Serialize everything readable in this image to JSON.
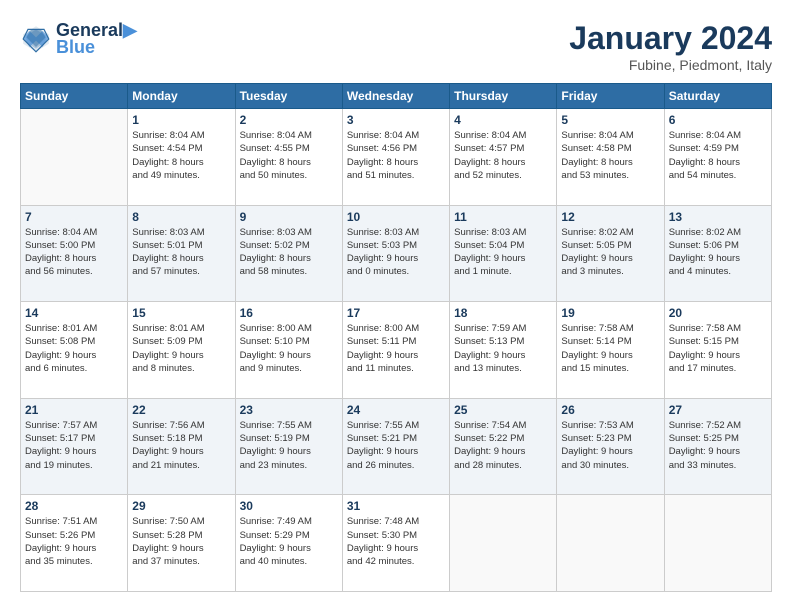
{
  "header": {
    "logo_line1": "General",
    "logo_line2": "Blue",
    "month": "January 2024",
    "location": "Fubine, Piedmont, Italy"
  },
  "days_of_week": [
    "Sunday",
    "Monday",
    "Tuesday",
    "Wednesday",
    "Thursday",
    "Friday",
    "Saturday"
  ],
  "weeks": [
    [
      {
        "day": "",
        "info": ""
      },
      {
        "day": "1",
        "info": "Sunrise: 8:04 AM\nSunset: 4:54 PM\nDaylight: 8 hours\nand 49 minutes."
      },
      {
        "day": "2",
        "info": "Sunrise: 8:04 AM\nSunset: 4:55 PM\nDaylight: 8 hours\nand 50 minutes."
      },
      {
        "day": "3",
        "info": "Sunrise: 8:04 AM\nSunset: 4:56 PM\nDaylight: 8 hours\nand 51 minutes."
      },
      {
        "day": "4",
        "info": "Sunrise: 8:04 AM\nSunset: 4:57 PM\nDaylight: 8 hours\nand 52 minutes."
      },
      {
        "day": "5",
        "info": "Sunrise: 8:04 AM\nSunset: 4:58 PM\nDaylight: 8 hours\nand 53 minutes."
      },
      {
        "day": "6",
        "info": "Sunrise: 8:04 AM\nSunset: 4:59 PM\nDaylight: 8 hours\nand 54 minutes."
      }
    ],
    [
      {
        "day": "7",
        "info": "Sunrise: 8:04 AM\nSunset: 5:00 PM\nDaylight: 8 hours\nand 56 minutes."
      },
      {
        "day": "8",
        "info": "Sunrise: 8:03 AM\nSunset: 5:01 PM\nDaylight: 8 hours\nand 57 minutes."
      },
      {
        "day": "9",
        "info": "Sunrise: 8:03 AM\nSunset: 5:02 PM\nDaylight: 8 hours\nand 58 minutes."
      },
      {
        "day": "10",
        "info": "Sunrise: 8:03 AM\nSunset: 5:03 PM\nDaylight: 9 hours\nand 0 minutes."
      },
      {
        "day": "11",
        "info": "Sunrise: 8:03 AM\nSunset: 5:04 PM\nDaylight: 9 hours\nand 1 minute."
      },
      {
        "day": "12",
        "info": "Sunrise: 8:02 AM\nSunset: 5:05 PM\nDaylight: 9 hours\nand 3 minutes."
      },
      {
        "day": "13",
        "info": "Sunrise: 8:02 AM\nSunset: 5:06 PM\nDaylight: 9 hours\nand 4 minutes."
      }
    ],
    [
      {
        "day": "14",
        "info": "Sunrise: 8:01 AM\nSunset: 5:08 PM\nDaylight: 9 hours\nand 6 minutes."
      },
      {
        "day": "15",
        "info": "Sunrise: 8:01 AM\nSunset: 5:09 PM\nDaylight: 9 hours\nand 8 minutes."
      },
      {
        "day": "16",
        "info": "Sunrise: 8:00 AM\nSunset: 5:10 PM\nDaylight: 9 hours\nand 9 minutes."
      },
      {
        "day": "17",
        "info": "Sunrise: 8:00 AM\nSunset: 5:11 PM\nDaylight: 9 hours\nand 11 minutes."
      },
      {
        "day": "18",
        "info": "Sunrise: 7:59 AM\nSunset: 5:13 PM\nDaylight: 9 hours\nand 13 minutes."
      },
      {
        "day": "19",
        "info": "Sunrise: 7:58 AM\nSunset: 5:14 PM\nDaylight: 9 hours\nand 15 minutes."
      },
      {
        "day": "20",
        "info": "Sunrise: 7:58 AM\nSunset: 5:15 PM\nDaylight: 9 hours\nand 17 minutes."
      }
    ],
    [
      {
        "day": "21",
        "info": "Sunrise: 7:57 AM\nSunset: 5:17 PM\nDaylight: 9 hours\nand 19 minutes."
      },
      {
        "day": "22",
        "info": "Sunrise: 7:56 AM\nSunset: 5:18 PM\nDaylight: 9 hours\nand 21 minutes."
      },
      {
        "day": "23",
        "info": "Sunrise: 7:55 AM\nSunset: 5:19 PM\nDaylight: 9 hours\nand 23 minutes."
      },
      {
        "day": "24",
        "info": "Sunrise: 7:55 AM\nSunset: 5:21 PM\nDaylight: 9 hours\nand 26 minutes."
      },
      {
        "day": "25",
        "info": "Sunrise: 7:54 AM\nSunset: 5:22 PM\nDaylight: 9 hours\nand 28 minutes."
      },
      {
        "day": "26",
        "info": "Sunrise: 7:53 AM\nSunset: 5:23 PM\nDaylight: 9 hours\nand 30 minutes."
      },
      {
        "day": "27",
        "info": "Sunrise: 7:52 AM\nSunset: 5:25 PM\nDaylight: 9 hours\nand 33 minutes."
      }
    ],
    [
      {
        "day": "28",
        "info": "Sunrise: 7:51 AM\nSunset: 5:26 PM\nDaylight: 9 hours\nand 35 minutes."
      },
      {
        "day": "29",
        "info": "Sunrise: 7:50 AM\nSunset: 5:28 PM\nDaylight: 9 hours\nand 37 minutes."
      },
      {
        "day": "30",
        "info": "Sunrise: 7:49 AM\nSunset: 5:29 PM\nDaylight: 9 hours\nand 40 minutes."
      },
      {
        "day": "31",
        "info": "Sunrise: 7:48 AM\nSunset: 5:30 PM\nDaylight: 9 hours\nand 42 minutes."
      },
      {
        "day": "",
        "info": ""
      },
      {
        "day": "",
        "info": ""
      },
      {
        "day": "",
        "info": ""
      }
    ]
  ]
}
